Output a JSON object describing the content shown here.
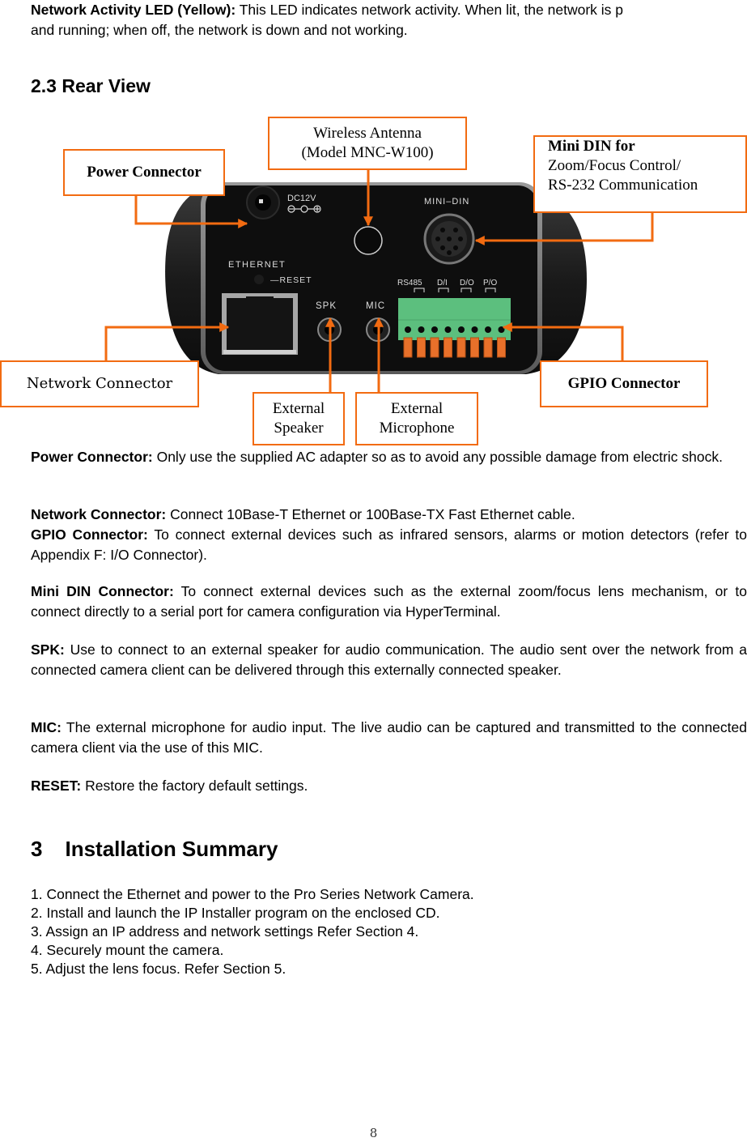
{
  "intro": {
    "label": "Network Activity LED (Yellow):",
    "text": " This LED indicates network activity. When lit, the network is p",
    "text2": "and running; when off, the network is down and not working."
  },
  "section_rear": {
    "title": "2.3 Rear View"
  },
  "diagram": {
    "callouts": {
      "power": "Power Connector",
      "wireless_line1": "Wireless Antenna",
      "wireless_line2": "(Model MNC-W100)",
      "minidin_line1": "Mini DIN for",
      "minidin_line2": "Zoom/Focus Control/",
      "minidin_line3": "RS-232 Communication",
      "network": "Network Connector",
      "gpio": "GPIO Connector",
      "speaker_line1": "External",
      "speaker_line2": "Speaker",
      "mic_line1": "External",
      "mic_line2": "Microphone"
    },
    "panel_labels": {
      "dc": "DC12V",
      "ethernet": "ETHERNET",
      "reset": "—RESET",
      "spk": "SPK",
      "mic": "MIC",
      "minidin": "MINI–DIN",
      "rs485": "RS485",
      "di": "D/I",
      "do": "D/O",
      "po": "P/O"
    },
    "colors": {
      "callout_border": "#f26b11",
      "terminal_green": "#5cbf7e",
      "terminal_orange": "#e8702a"
    }
  },
  "descriptions": [
    {
      "label": "Power Connector:",
      "text": " Only use the supplied AC adapter so as to avoid any possible damage from electric shock."
    },
    {
      "label": "Network Connector:",
      "text": " Connect 10Base-T Ethernet or 100Base-TX Fast Ethernet cable."
    },
    {
      "label": "GPIO Connector:",
      "text": " To connect external devices such as infrared sensors, alarms or motion detectors (refer to Appendix F: I/O Connector)."
    },
    {
      "label": "Mini DIN Connector:",
      "text": " To connect external devices such as the external zoom/focus lens mechanism, or to connect directly to a serial port for camera configuration via HyperTerminal."
    },
    {
      "label": "SPK:",
      "text": " Use to connect to an external speaker for audio communication. The audio sent over the network from a connected camera client can be delivered through this externally connected speaker."
    },
    {
      "label": "MIC:",
      "text": " The external microphone for audio input. The live audio can be captured and transmitted to the connected camera client via the use of this MIC."
    },
    {
      "label": "RESET:",
      "text": " Restore the factory default settings."
    }
  ],
  "section_install": {
    "number": "3",
    "title": "Installation Summary",
    "steps": [
      "1. Connect the Ethernet and power to the Pro Series Network Camera.",
      "2. Install and launch the IP Installer program on the enclosed CD.",
      "3. Assign an IP address and network settings Refer Section 4.",
      "4. Securely mount the camera.",
      "5. Adjust the lens focus. Refer Section 5."
    ]
  },
  "footer": {
    "page_number": "8"
  }
}
